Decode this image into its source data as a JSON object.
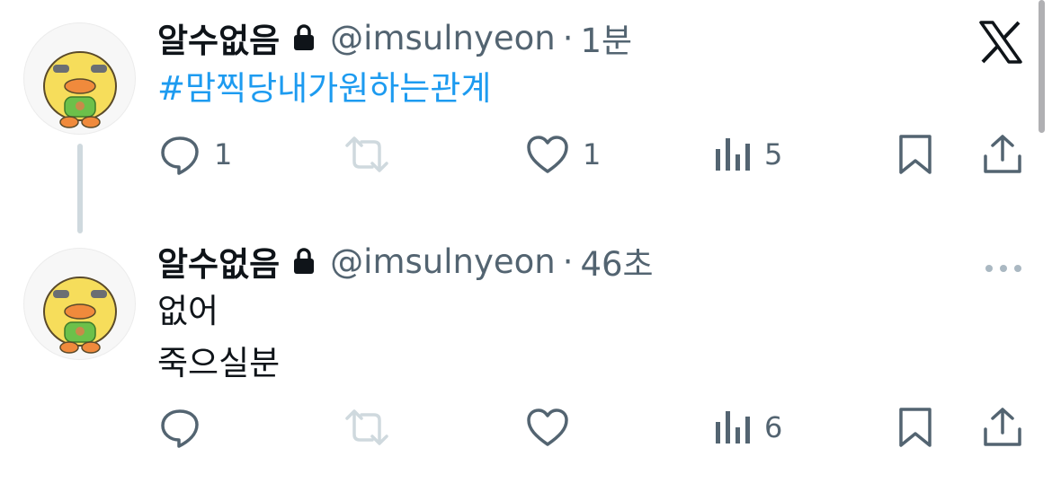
{
  "tweets": [
    {
      "display_name": "알수없음",
      "handle": "@imsulnyeon",
      "time": "1분",
      "text_lines": [
        "#맘찍당내가원하는관계"
      ],
      "reply_count": "1",
      "like_count": "1",
      "view_count": "5"
    },
    {
      "display_name": "알수없음",
      "handle": "@imsulnyeon",
      "time": "46초",
      "text_lines": [
        "없어",
        "죽으실분"
      ],
      "reply_count": "",
      "like_count": "",
      "view_count": "6"
    }
  ],
  "separator": "·",
  "colors": {
    "text": "#0f1419",
    "muted": "#536471",
    "link": "#1d9bf0",
    "thread_line": "#cfd9de",
    "retweet_disabled": "#cfd9de",
    "avatar_face": "#f6dd5b"
  },
  "icons": {
    "platform_logo": "x-logo-icon",
    "lock": "lock-icon",
    "reply": "reply-icon",
    "retweet": "retweet-icon",
    "like": "heart-icon",
    "views": "views-icon",
    "bookmark": "bookmark-icon",
    "share": "share-icon",
    "more": "more-icon"
  }
}
